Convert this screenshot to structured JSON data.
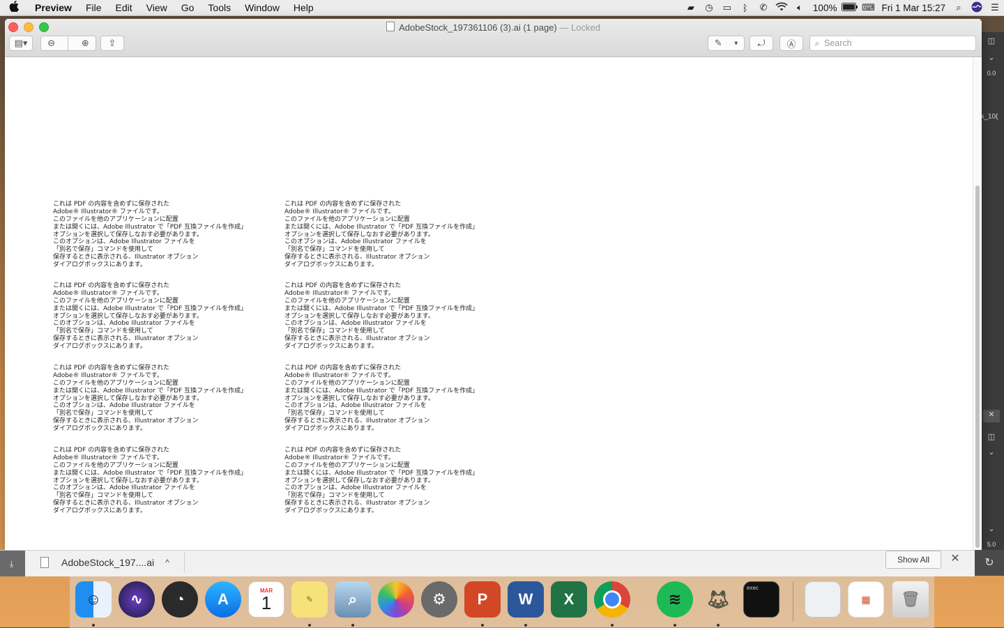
{
  "menubar": {
    "apple": "",
    "items": [
      "Preview",
      "File",
      "Edit",
      "View",
      "Go",
      "Tools",
      "Window",
      "Help"
    ],
    "battery": "100%",
    "datetime": "Fri 1 Mar  15:27"
  },
  "window": {
    "title": "AdobeStock_197361106 (3).ai (1 page)",
    "title_suffix": "— Locked",
    "search_placeholder": "Search"
  },
  "document": {
    "blocks": [
      [
        "これは PDF の内容を含めずに保存された",
        "Adobe® Illustrator® ファイルです。",
        "このファイルを他のアプリケーションに配置",
        "または開くには、Adobe Illustrator で「PDF 互換ファイルを作成」",
        "オプションを選択して保存しなおす必要があります。",
        "このオプションは、Adobe Illustrator ファイルを",
        "「別名で保存」コマンドを使用して",
        "保存するときに表示される、Illustrator オプション",
        "ダイアログボックスにあります。"
      ],
      [
        "これは PDF の内容を含めずに保存された",
        "Adobe® Illustrator® ファイルです。",
        "このファイルを他のアプリケーションに配置",
        "または開くには、Adobe Illustrator で「PDF 互換ファイルを作成」",
        "オプションを選択して保存しなおす必要があります。",
        "このオプションは、Adobe Illustrator ファイルを",
        "「別名で保存」コマンドを使用して",
        "保存するときに表示される、Illustrator オプション",
        "ダイアログボックスにあります。"
      ],
      [
        "これは PDF の内容を含めずに保存された",
        "Adobe® Illustrator® ファイルです。",
        "このファイルを他のアプリケーションに配置",
        "または開くには、Adobe Illustrator で「PDF 互換ファイルを作成」",
        "オプションを選択して保存しなおす必要があります。",
        "このオプションは、Adobe Illustrator ファイルを",
        "「別名で保存」コマンドを使用して",
        "保存するときに表示される、Illustrator オプション",
        "ダイアログボックスにあります。"
      ],
      [
        "これは PDF の内容を含めずに保存された",
        "Adobe® Illustrator® ファイルです。",
        "このファイルを他のアプリケーションに配置",
        "または開くには、Adobe Illustrator で「PDF 互換ファイルを作成」",
        "オプションを選択して保存しなおす必要があります。",
        "このオプションは、Adobe Illustrator ファイルを",
        "「別名で保存」コマンドを使用して",
        "保存するときに表示される、Illustrator オプション",
        "ダイアログボックスにあります。"
      ],
      [
        "これは PDF の内容を含めずに保存された",
        "Adobe® Illustrator® ファイルです。",
        "このファイルを他のアプリケーションに配置",
        "または開くには、Adobe Illustrator で「PDF 互換ファイルを作成」",
        "オプションを選択して保存しなおす必要があります。",
        "このオプションは、Adobe Illustrator ファイルを",
        "「別名で保存」コマンドを使用して",
        "保存するときに表示される、Illustrator オプション",
        "ダイアログボックスにあります。"
      ],
      [
        "これは PDF の内容を含めずに保存された",
        "Adobe® Illustrator® ファイルです。",
        "このファイルを他のアプリケーションに配置",
        "または開くには、Adobe Illustrator で「PDF 互換ファイルを作成」",
        "オプションを選択して保存しなおす必要があります。",
        "このオプションは、Adobe Illustrator ファイルを",
        "「別名で保存」コマンドを使用して",
        "保存するときに表示される、Illustrator オプション",
        "ダイアログボックスにあります。"
      ],
      [
        "これは PDF の内容を含めずに保存された",
        "Adobe® Illustrator® ファイルです。",
        "このファイルを他のアプリケーションに配置",
        "または開くには、Adobe Illustrator で「PDF 互換ファイルを作成」",
        "オプションを選択して保存しなおす必要があります。",
        "このオプションは、Adobe Illustrator ファイルを",
        "「別名で保存」コマンドを使用して",
        "保存するときに表示される、Illustrator オプション",
        "ダイアログボックスにあります。"
      ],
      [
        "これは PDF の内容を含めずに保存された",
        "Adobe® Illustrator® ファイルです。",
        "このファイルを他のアプリケーションに配置",
        "または開くには、Adobe Illustrator で「PDF 互換ファイルを作成」",
        "オプションを選択して保存しなおす必要があります。",
        "このオプションは、Adobe Illustrator ファイルを",
        "「別名で保存」コマンドを使用して",
        "保存するときに表示される、Illustrator オプション",
        "ダイアログボックスにあります。"
      ]
    ]
  },
  "download_bar": {
    "filename": "AdobeStock_197....ai",
    "show_all": "Show All"
  },
  "background_window": {
    "zoom_top": "0.0",
    "tab_fragment": "k_10(",
    "zoom_bottom": "5.0"
  },
  "dock": {
    "apps": [
      "finder",
      "siri",
      "launchpad",
      "app-store",
      "calendar",
      "stickies",
      "preview",
      "photos",
      "system-preferences",
      "powerpoint",
      "word",
      "excel",
      "chrome",
      "spotify",
      "gimp",
      "terminal"
    ],
    "calendar_month": "MAR",
    "calendar_day": "1",
    "terminal_label": "exec"
  },
  "colors": {
    "accent_red": "#fc605c",
    "accent_yellow": "#fdbc40",
    "accent_green": "#34c84a"
  }
}
